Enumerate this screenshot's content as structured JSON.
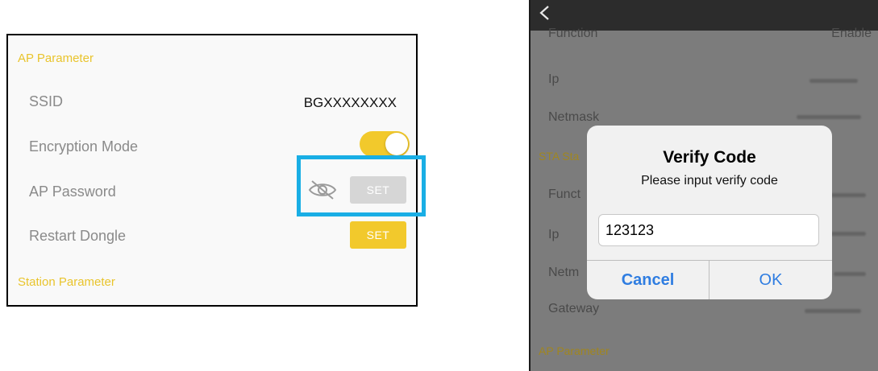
{
  "left_panel": {
    "ap_section_title": "AP Parameter",
    "ssid_label": "SSID",
    "ssid_value": "BGXXXXXXXX",
    "encryption_label": "Encryption Mode",
    "encryption_enabled": true,
    "password_label": "AP Password",
    "password_set_label": "SET",
    "restart_label": "Restart Dongle",
    "restart_set_label": "SET",
    "station_section_title": "Station Parameter",
    "accent_color": "#f2c92c",
    "highlight_color": "#19aee5"
  },
  "right_panel": {
    "function_top_label": "Function",
    "function_top_value": "Enable",
    "ip_label": "Ip",
    "netmask_label": "Netmask",
    "sta_section_partial": "STA Sta",
    "function_partial": "Funct",
    "ip2_label": "Ip",
    "netmask_partial": "Netm",
    "gateway_label": "Gateway",
    "ap_section_title": "AP Parameter"
  },
  "dialog": {
    "title": "Verify Code",
    "message": "Please input verify code",
    "input_value": "123123",
    "cancel_label": "Cancel",
    "ok_label": "OK",
    "button_color": "#2f7de1"
  }
}
